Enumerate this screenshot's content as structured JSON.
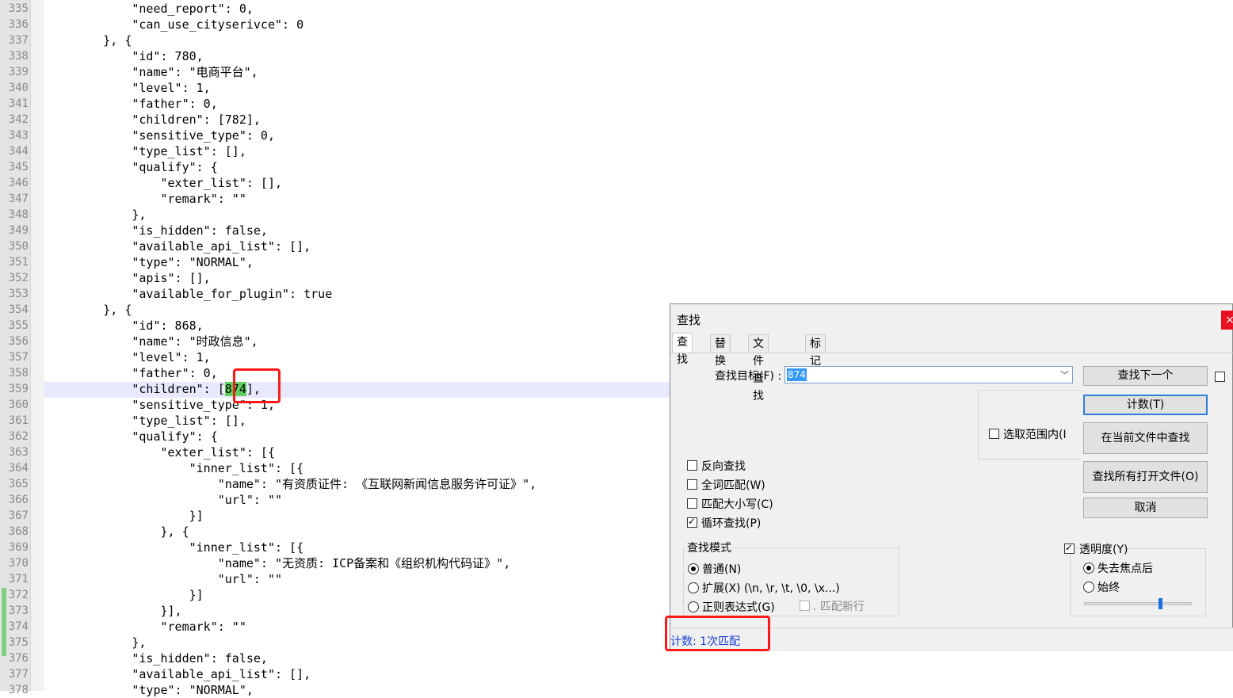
{
  "editor": {
    "lines": [
      {
        "n": "335",
        "t": "            \"need_report\": 0,"
      },
      {
        "n": "336",
        "t": "            \"can_use_cityserivce\": 0"
      },
      {
        "n": "337",
        "t": "        }, {"
      },
      {
        "n": "338",
        "t": "            \"id\": 780,"
      },
      {
        "n": "339",
        "t": "            \"name\": \"电商平台\","
      },
      {
        "n": "340",
        "t": "            \"level\": 1,"
      },
      {
        "n": "341",
        "t": "            \"father\": 0,"
      },
      {
        "n": "342",
        "t": "            \"children\": [782],"
      },
      {
        "n": "343",
        "t": "            \"sensitive_type\": 0,"
      },
      {
        "n": "344",
        "t": "            \"type_list\": [],"
      },
      {
        "n": "345",
        "t": "            \"qualify\": {"
      },
      {
        "n": "346",
        "t": "                \"exter_list\": [],"
      },
      {
        "n": "347",
        "t": "                \"remark\": \"\""
      },
      {
        "n": "348",
        "t": "            },"
      },
      {
        "n": "349",
        "t": "            \"is_hidden\": false,"
      },
      {
        "n": "350",
        "t": "            \"available_api_list\": [],"
      },
      {
        "n": "351",
        "t": "            \"type\": \"NORMAL\","
      },
      {
        "n": "352",
        "t": "            \"apis\": [],"
      },
      {
        "n": "353",
        "t": "            \"available_for_plugin\": true"
      },
      {
        "n": "354",
        "t": "        }, {"
      },
      {
        "n": "355",
        "t": "            \"id\": 868,"
      },
      {
        "n": "356",
        "t": "            \"name\": \"时政信息\","
      },
      {
        "n": "357",
        "t": "            \"level\": 1,"
      },
      {
        "n": "358",
        "t": "            \"father\": 0,"
      },
      {
        "n": "359",
        "pre": "            \"children\": [",
        "hl": "874",
        "post": "],"
      },
      {
        "n": "360",
        "t": "            \"sensitive_type\": 1,"
      },
      {
        "n": "361",
        "t": "            \"type_list\": [],"
      },
      {
        "n": "362",
        "t": "            \"qualify\": {"
      },
      {
        "n": "363",
        "t": "                \"exter_list\": [{"
      },
      {
        "n": "364",
        "t": "                    \"inner_list\": [{"
      },
      {
        "n": "365",
        "t": "                        \"name\": \"有资质证件: 《互联网新闻信息服务许可证》\","
      },
      {
        "n": "366",
        "t": "                        \"url\": \"\""
      },
      {
        "n": "367",
        "t": "                    }]"
      },
      {
        "n": "368",
        "t": "                }, {"
      },
      {
        "n": "369",
        "t": "                    \"inner_list\": [{"
      },
      {
        "n": "370",
        "t": "                        \"name\": \"无资质: ICP备案和《组织机构代码证》\","
      },
      {
        "n": "371",
        "t": "                        \"url\": \"\""
      },
      {
        "n": "372",
        "t": "                    }]"
      },
      {
        "n": "373",
        "t": "                }],"
      },
      {
        "n": "374",
        "t": "                \"remark\": \"\""
      },
      {
        "n": "375",
        "t": "            },"
      },
      {
        "n": "376",
        "t": "            \"is_hidden\": false,"
      },
      {
        "n": "377",
        "t": "            \"available_api_list\": [],"
      },
      {
        "n": "378",
        "t": "            \"type\": \"NORMAL\","
      }
    ]
  },
  "dialog": {
    "title": "查找",
    "close": "×",
    "tabs": [
      "查找",
      "替换",
      "文件查找",
      "标记"
    ],
    "target_label": "查找目标(F) :",
    "target_value": "874",
    "in_selection": "选取范围内(I",
    "options": {
      "reverse": "反向查找",
      "whole_word": "全词匹配(W)",
      "match_case": "匹配大小写(C)",
      "wrap": "循环查找(P)"
    },
    "mode_title": "查找模式",
    "modes": {
      "normal": "普通(N)",
      "extended": "扩展(X) (\\n, \\r, \\t, \\0, \\x...)",
      "regex": "正则表达式(G)",
      "newline": ". 匹配新行"
    },
    "transparency": {
      "label": "透明度(Y)",
      "on_lose_focus": "失去焦点后",
      "always": "始终",
      "level": 0.72
    },
    "buttons": {
      "find_next": "查找下一个",
      "count": "计数(T)",
      "find_in_current": "在当前文件中查找",
      "find_all_open": "查找所有打开文件(O)",
      "cancel": "取消"
    },
    "status": "计数: 1次匹配"
  }
}
